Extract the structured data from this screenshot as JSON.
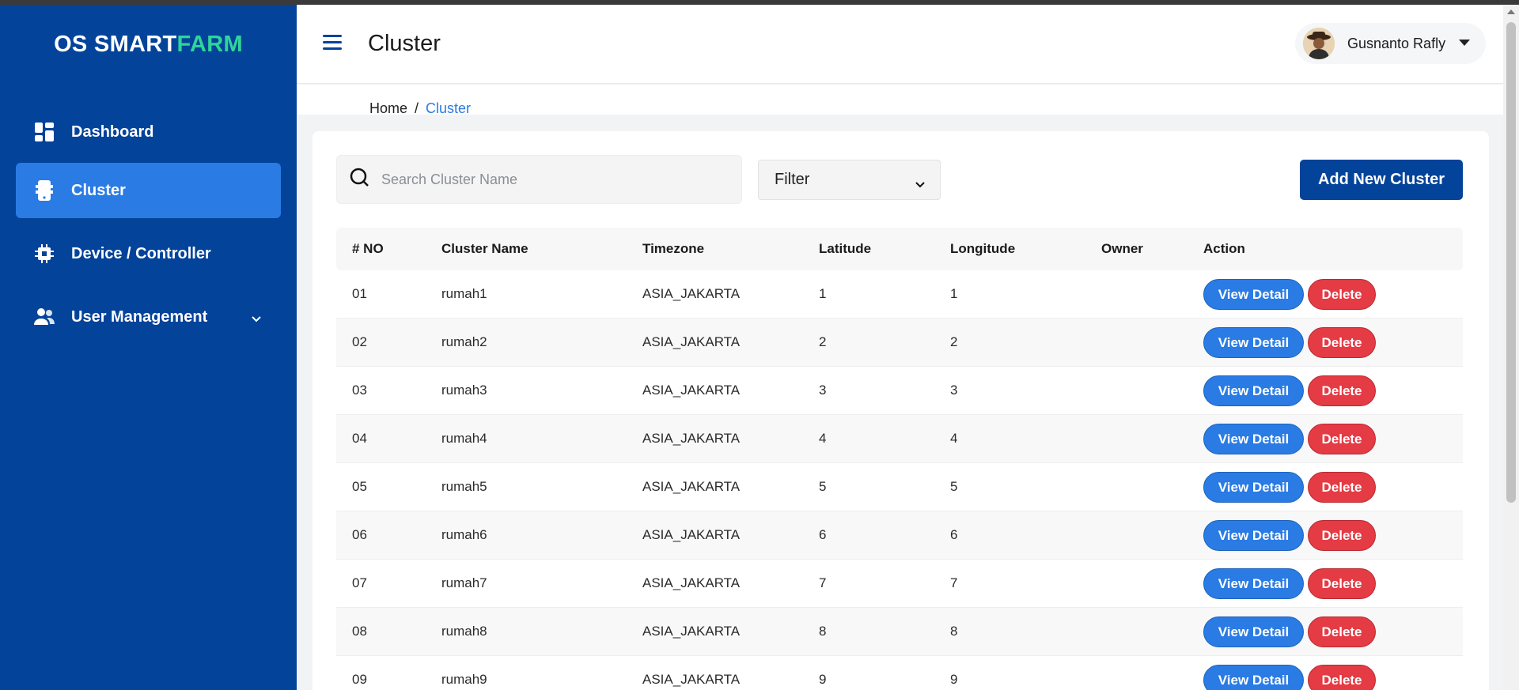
{
  "brand": {
    "part1": "OS SMART",
    "part2": "FARM",
    "accent_color": "#2fd59a"
  },
  "sidebar": {
    "items": [
      {
        "label": "Dashboard",
        "icon": "dashboard-icon",
        "active": false
      },
      {
        "label": "Cluster",
        "icon": "phone-device-icon",
        "active": true
      },
      {
        "label": "Device / Controller",
        "icon": "chip-icon",
        "active": false
      },
      {
        "label": "User Management",
        "icon": "users-icon",
        "active": false,
        "has_submenu": true
      }
    ]
  },
  "header": {
    "title": "Cluster",
    "user_name": "Gusnanto Rafly"
  },
  "breadcrumb": {
    "home": "Home",
    "separator": "/",
    "current": "Cluster"
  },
  "toolbar": {
    "search_placeholder": "Search Cluster Name",
    "filter_label": "Filter",
    "add_label": "Add New Cluster"
  },
  "table": {
    "headers": [
      "# NO",
      "Cluster Name",
      "Timezone",
      "Latitude",
      "Longitude",
      "Owner",
      "Action"
    ],
    "view_label": "View Detail",
    "delete_label": "Delete",
    "rows": [
      {
        "no": "01",
        "name": "rumah1",
        "timezone": "ASIA_JAKARTA",
        "lat": "1",
        "lon": "1",
        "owner": ""
      },
      {
        "no": "02",
        "name": "rumah2",
        "timezone": "ASIA_JAKARTA",
        "lat": "2",
        "lon": "2",
        "owner": ""
      },
      {
        "no": "03",
        "name": "rumah3",
        "timezone": "ASIA_JAKARTA",
        "lat": "3",
        "lon": "3",
        "owner": ""
      },
      {
        "no": "04",
        "name": "rumah4",
        "timezone": "ASIA_JAKARTA",
        "lat": "4",
        "lon": "4",
        "owner": ""
      },
      {
        "no": "05",
        "name": "rumah5",
        "timezone": "ASIA_JAKARTA",
        "lat": "5",
        "lon": "5",
        "owner": ""
      },
      {
        "no": "06",
        "name": "rumah6",
        "timezone": "ASIA_JAKARTA",
        "lat": "6",
        "lon": "6",
        "owner": ""
      },
      {
        "no": "07",
        "name": "rumah7",
        "timezone": "ASIA_JAKARTA",
        "lat": "7",
        "lon": "7",
        "owner": ""
      },
      {
        "no": "08",
        "name": "rumah8",
        "timezone": "ASIA_JAKARTA",
        "lat": "8",
        "lon": "8",
        "owner": ""
      },
      {
        "no": "09",
        "name": "rumah9",
        "timezone": "ASIA_JAKARTA",
        "lat": "9",
        "lon": "9",
        "owner": ""
      }
    ]
  },
  "colors": {
    "sidebar_bg": "#03439a",
    "active_item": "#2a7be4",
    "view_button": "#2a7be4",
    "delete_button": "#e43b44",
    "add_button": "#03439a"
  }
}
